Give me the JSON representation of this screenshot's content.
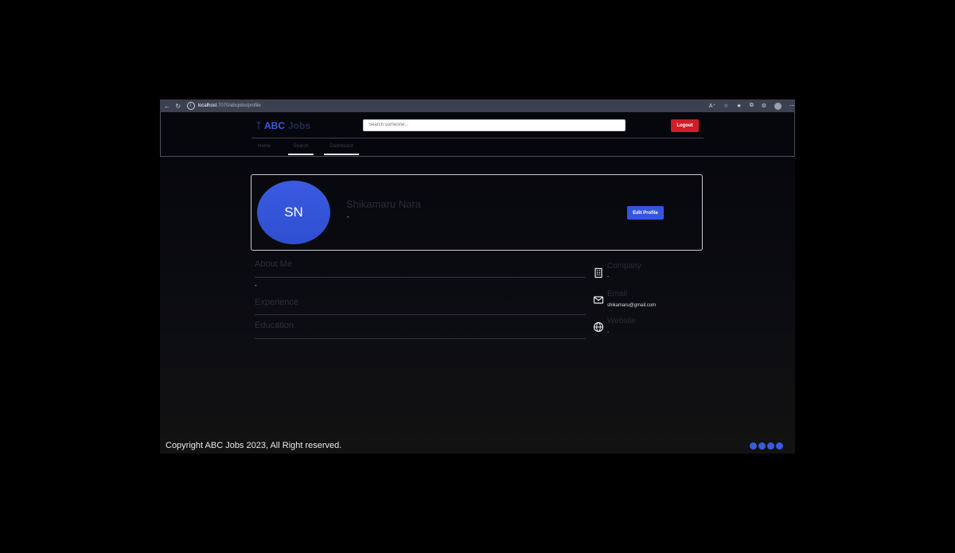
{
  "browser": {
    "url_host": "localhost",
    "url_path": ":7070/abcjobs/profile"
  },
  "brand": {
    "abc": "ABC",
    "jobs": "Jobs"
  },
  "search": {
    "placeholder": "Search someone..."
  },
  "header": {
    "logout_label": "Logout"
  },
  "tabs": [
    {
      "label": "Home"
    },
    {
      "label": "Search"
    },
    {
      "label": "Dashboard"
    }
  ],
  "profile": {
    "initials": "SN",
    "name": "Shikamaru Nara",
    "subtitle": "-",
    "edit_label": "Edit Profile"
  },
  "sections": {
    "about": {
      "title": "About Me",
      "value": "-"
    },
    "experience": {
      "title": "Experience"
    },
    "education": {
      "title": "Education"
    }
  },
  "info": {
    "company": {
      "label": "Company",
      "value": "-",
      "icon": "building-icon"
    },
    "email": {
      "label": "Email",
      "value": "shikamaru@gmail.com",
      "icon": "mail-icon"
    },
    "website": {
      "label": "Website",
      "value": "-",
      "icon": "globe-icon"
    }
  },
  "footer": {
    "copyright": "Copyright ABC Jobs 2023, All Right reserved."
  },
  "colors": {
    "accent": "#3b5bdb",
    "logout": "#d11d27"
  }
}
